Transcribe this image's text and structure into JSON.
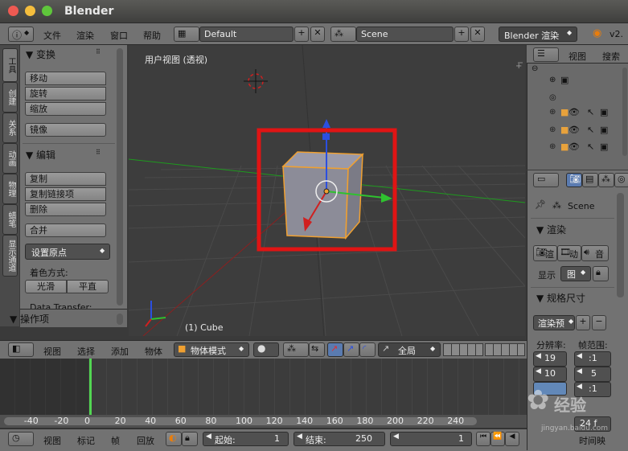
{
  "window": {
    "title": "Blender"
  },
  "info_header": {
    "menus": [
      "文件",
      "渲染",
      "窗口",
      "帮助"
    ],
    "layout": "Default",
    "scene": "Scene",
    "engine": "Blender 渲染",
    "version": "v2."
  },
  "tool_tabs": [
    "工具",
    "创建",
    "关系",
    "动画",
    "物理",
    "蜡笔",
    "显示通道"
  ],
  "tool_shelf": {
    "transform_title": "▼ 变换",
    "transform_buttons": [
      "移动",
      "旋转",
      "缩放"
    ],
    "mirror": "镜像",
    "edit_title": "▼ 编辑",
    "edit_buttons": [
      "复制",
      "复制链接项",
      "删除"
    ],
    "join": "合并",
    "set_origin": "设置原点",
    "shading_label": "着色方式:",
    "smooth": "光滑",
    "flat": "平直",
    "data_transfer": "Data Transfer:",
    "operator_title": "▼ 操作项"
  },
  "viewport": {
    "view_label": "用户视图 (透视)",
    "object_label": "(1) Cube"
  },
  "view3d_header": {
    "menus": [
      "视图",
      "选择",
      "添加",
      "物体"
    ],
    "mode": "物体模式",
    "orientation": "全局"
  },
  "timeline": {
    "ticks": [
      "-40",
      "-20",
      "0",
      "20",
      "40",
      "60",
      "80",
      "100",
      "120",
      "140",
      "160",
      "180",
      "200",
      "220",
      "240"
    ]
  },
  "timeline_header": {
    "menus": [
      "视图",
      "标记",
      "帧",
      "回放"
    ],
    "start_label": "起始:",
    "start_value": "1",
    "end_label": "结束:",
    "end_value": "250",
    "current": "1",
    "sync": "时间映"
  },
  "outliner": {
    "view": "视图",
    "search": "搜索"
  },
  "properties": {
    "scene": "Scene",
    "render_title": "▼ 渲染",
    "render_buttons": [
      "渲",
      "动",
      "音"
    ],
    "display_label": "显示",
    "display_value": "图",
    "dimensions_title": "▼ 规格尺寸",
    "preset": "渲染预",
    "resolution_label": "分辨率:",
    "frame_range_label": "帧范围:",
    "res_x": "19",
    "res_y": "10",
    "res_pct": "",
    "frame_a": ":1",
    "frame_b": "5",
    "frame_c": ":1",
    "fps": "24 f",
    "time_remap": "时间映"
  },
  "watermark": {
    "text": "经验",
    "sub": "jingyan.baidu.com"
  },
  "colors": {
    "highlight_box": "#e01414",
    "x_axis": "#2fc12f",
    "z_axis": "#2b4fe0",
    "y_axis": "#d02020",
    "select_orange": "#f0a030"
  }
}
